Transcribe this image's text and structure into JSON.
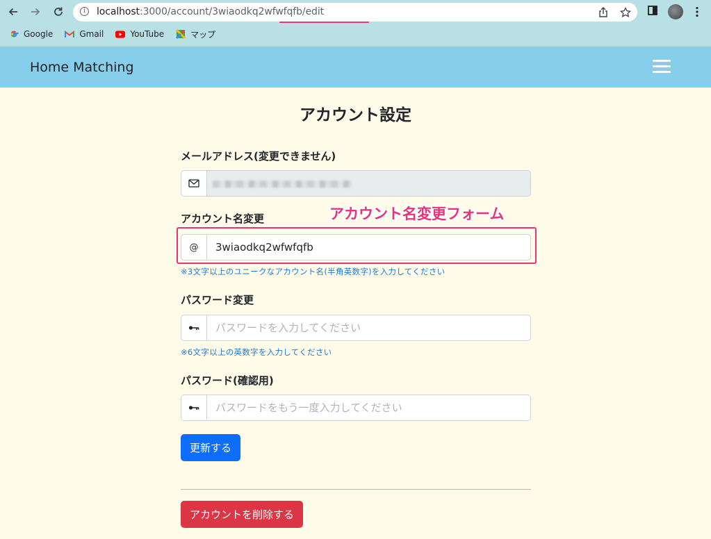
{
  "browser": {
    "url_host": "localhost",
    "url_rest": ":3000/account/",
    "url_id": "3wiaodkq2wfwfqfb",
    "url_tail": "/edit",
    "bookmarks": [
      {
        "label": "Google",
        "icon": "google-icon"
      },
      {
        "label": "Gmail",
        "icon": "gmail-icon"
      },
      {
        "label": "YouTube",
        "icon": "youtube-icon"
      },
      {
        "label": "マップ",
        "icon": "maps-icon"
      }
    ]
  },
  "navbar": {
    "brand": "Home Matching",
    "bg_color": "#87ceeb"
  },
  "form": {
    "title": "アカウント設定",
    "email": {
      "label": "メールアドレス(変更できません)",
      "icon": "envelope-icon"
    },
    "account_name": {
      "label": "アカウント名変更",
      "prefix": "@",
      "value": "3wiaodkq2wfwfqfb",
      "hint": "※3文字以上のユニークなアカウント名(半角英数字)を入力してください"
    },
    "password": {
      "label": "パスワード変更",
      "icon": "key-icon",
      "placeholder": "パスワードを入力してください",
      "hint": "※6文字以上の英数字を入力してください"
    },
    "password_confirm": {
      "label": "パスワード(確認用)",
      "icon": "key-icon",
      "placeholder": "パスワードをもう一度入力してください"
    },
    "update_button": "更新する",
    "delete_button": "アカウントを削除する"
  },
  "annotation": {
    "callout": "アカウント名変更フォーム",
    "color": "#e8357a"
  },
  "colors": {
    "primary": "#0d6efd",
    "danger": "#dc3545",
    "hint": "#1e7ad6",
    "page_bg": "#fefbe9"
  }
}
